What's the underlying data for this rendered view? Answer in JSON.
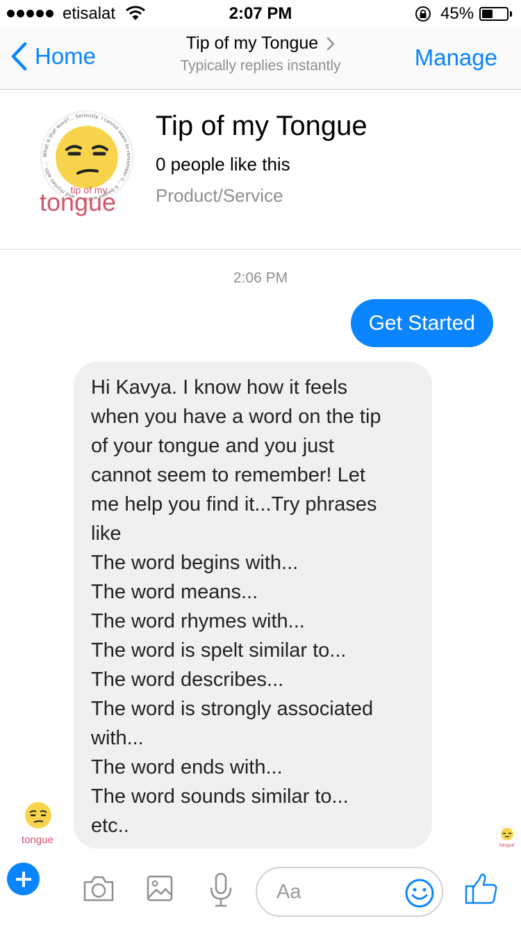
{
  "status_bar": {
    "carrier": "etisalat",
    "time": "2:07 PM",
    "battery": "45%",
    "battery_level": 0.45
  },
  "nav": {
    "back_label": "Home",
    "title": "Tip of my Tongue",
    "subtitle": "Typically replies instantly",
    "manage_label": "Manage"
  },
  "page": {
    "name": "Tip of my Tongue",
    "likes": "0 people like this",
    "category": "Product/Service",
    "logo_text_top": "tip of my",
    "logo_text_main": "tongue",
    "logo_ring_text": "What is that word?... Seriously, I cannot seem to remember it... It begins with a ... and rhymes with ..."
  },
  "chat": {
    "timestamp": "2:06 PM",
    "outgoing_message": "Get Started",
    "incoming_lines": [
      "Hi Kavya. I know how it feels",
      "when you have a word on the tip",
      "of your tongue and you just",
      "cannot seem to remember! Let",
      "me help you find it...Try phrases",
      "like",
      "The word begins with...",
      "The word means...",
      "The word rhymes with...",
      "The word is spelt similar to...",
      "The word describes...",
      "The word is strongly associated",
      "with...",
      "The word ends with...",
      "The word sounds similar to...",
      "etc.."
    ]
  },
  "composer": {
    "placeholder": "Aa",
    "icons": [
      "plus-icon",
      "camera-icon",
      "image-icon",
      "microphone-icon",
      "emoji-icon",
      "thumbs-up-icon"
    ]
  },
  "colors": {
    "accent": "#0a84ff",
    "incoming_bubble": "#f1f0f0",
    "secondary_text": "#8e8e93",
    "logo_face": "#f7d44c",
    "logo_text": "#d4546a"
  }
}
